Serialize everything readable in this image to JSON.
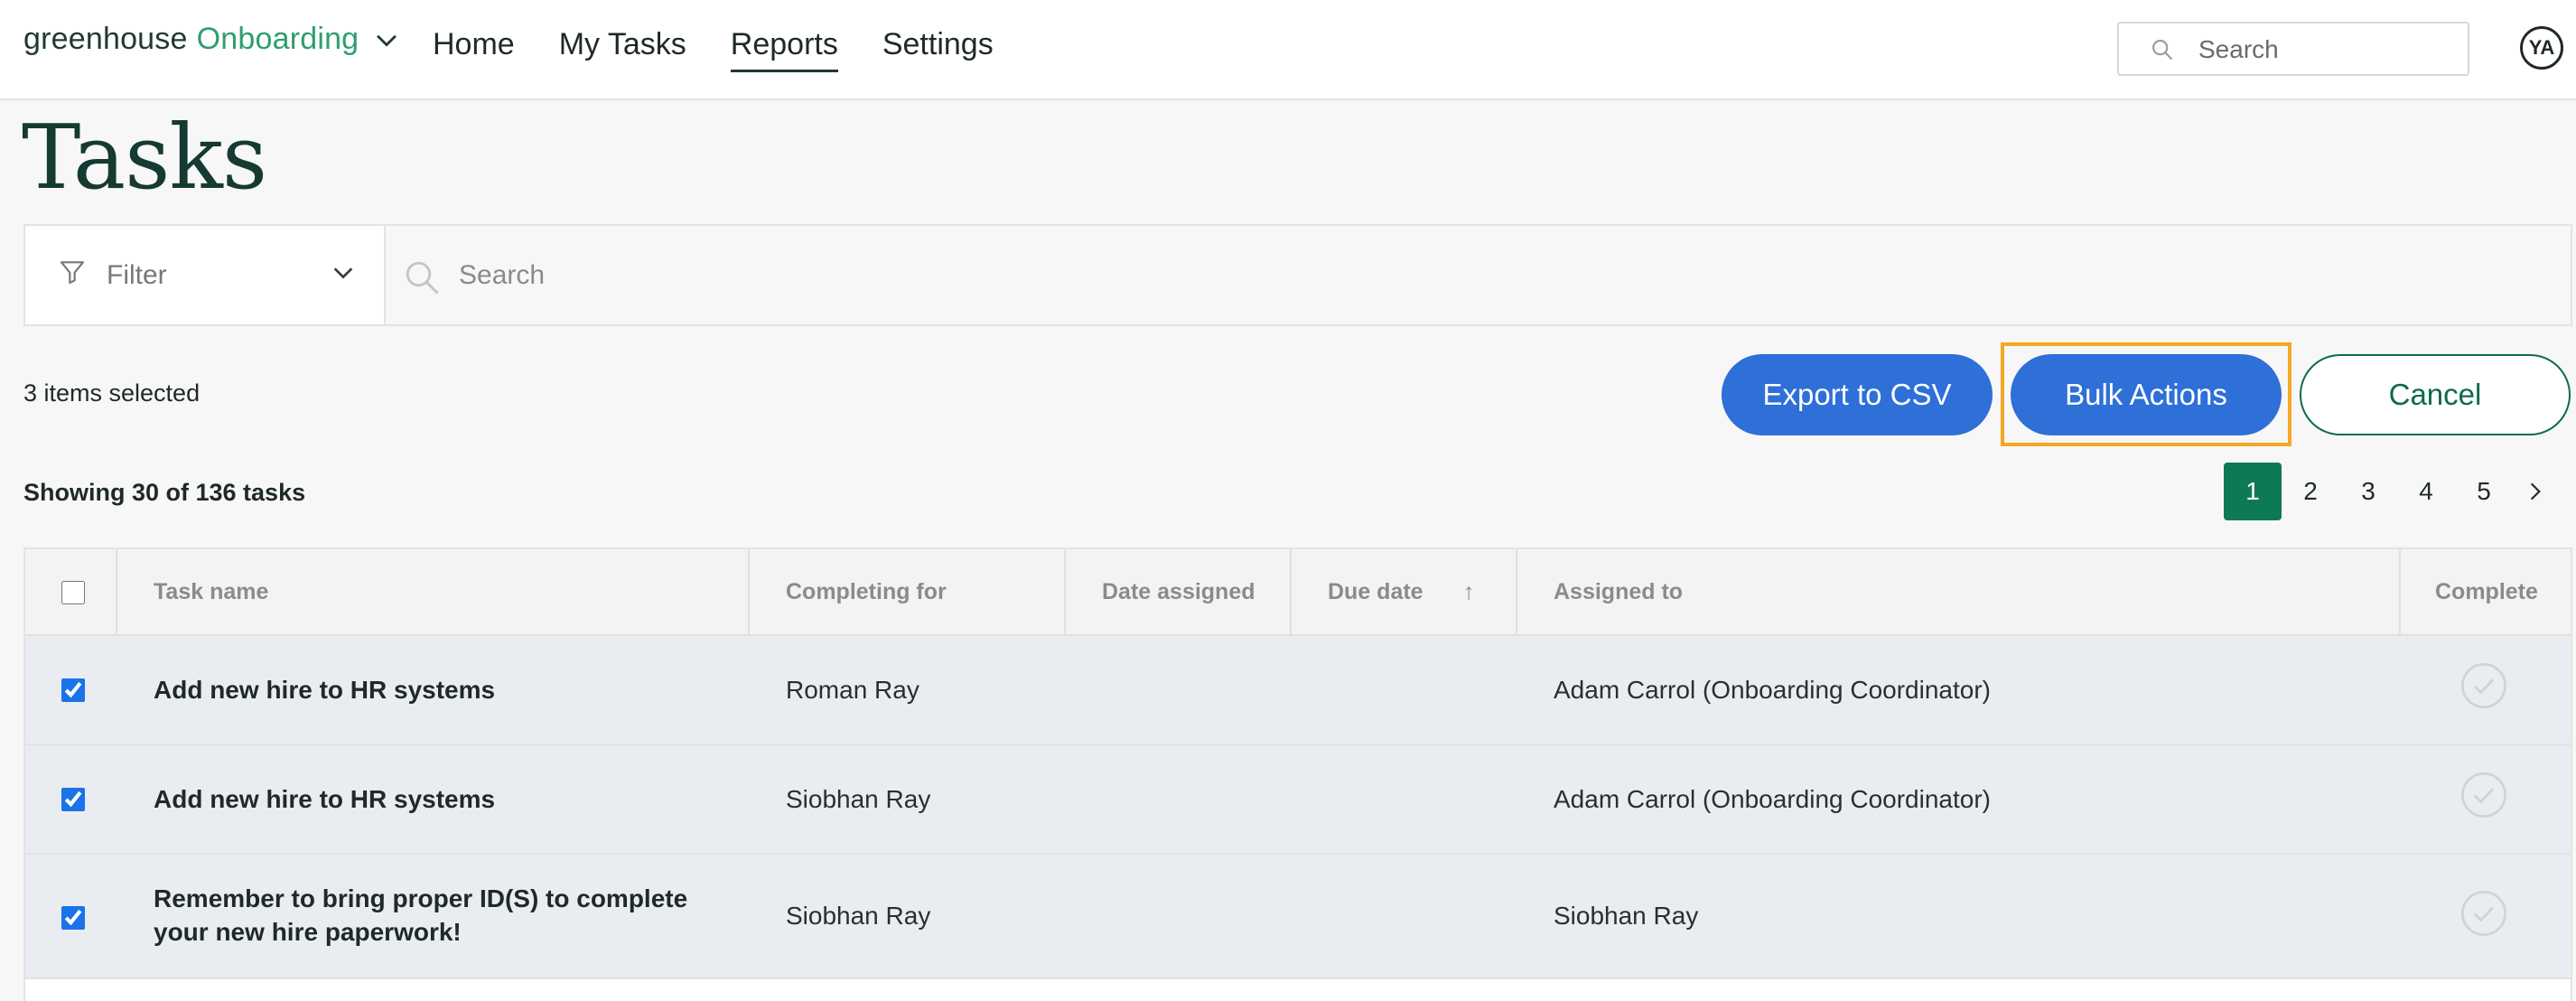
{
  "brand": {
    "name_dark": "greenhouse",
    "name_green": "Onboarding"
  },
  "nav": {
    "items": [
      {
        "label": "Home"
      },
      {
        "label": "My Tasks"
      },
      {
        "label": "Reports"
      },
      {
        "label": "Settings"
      }
    ],
    "active": "Reports"
  },
  "top_search": {
    "placeholder": "Search"
  },
  "user": {
    "initials": "YA"
  },
  "page": {
    "title": "Tasks"
  },
  "filter": {
    "label": "Filter",
    "search_placeholder": "Search"
  },
  "selection": {
    "summary": "3 items selected",
    "export_label": "Export to CSV",
    "bulk_label": "Bulk Actions",
    "cancel_label": "Cancel"
  },
  "listing": {
    "showing": "Showing 30 of 136 tasks"
  },
  "pagination": {
    "pages": [
      "1",
      "2",
      "3",
      "4",
      "5"
    ],
    "current": "1"
  },
  "table": {
    "columns": {
      "task_name": "Task name",
      "completing_for": "Completing for",
      "date_assigned": "Date assigned",
      "due_date": "Due date",
      "due_date_sort": "↑",
      "assigned_to": "Assigned to",
      "complete": "Complete"
    },
    "rows": [
      {
        "task": "Add new hire to HR systems",
        "completing_for": "Roman Ray",
        "date_assigned": "",
        "due_date": "",
        "assigned_to": "Adam Carrol (Onboarding Coordinator)",
        "selected": true
      },
      {
        "task": "Add new hire to HR systems",
        "completing_for": "Siobhan Ray",
        "date_assigned": "",
        "due_date": "",
        "assigned_to": "Adam Carrol (Onboarding Coordinator)",
        "selected": true
      },
      {
        "task_line1": "Remember to bring proper ID(S) to complete",
        "task_line2": "your new hire paperwork!",
        "completing_for": "Siobhan Ray",
        "date_assigned": "",
        "due_date": "",
        "assigned_to": "Siobhan Ray",
        "selected": true
      }
    ]
  },
  "colors": {
    "brand_dark": "#1f3a32",
    "brand_green": "#2e9e70",
    "primary_button": "#2e6fd8",
    "cancel_border": "#0f6b4a",
    "current_page": "#0e7a55",
    "highlight": "#f5a623"
  }
}
